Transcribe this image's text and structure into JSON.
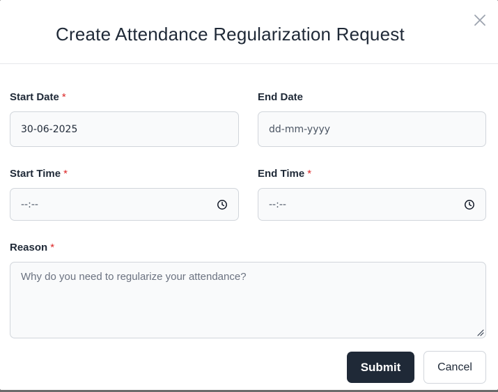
{
  "modal": {
    "title": "Create Attendance Regularization Request",
    "close_icon": "close-icon"
  },
  "form": {
    "start_date": {
      "label": "Start Date",
      "required_mark": "*",
      "value": "30-06-2025"
    },
    "end_date": {
      "label": "End Date",
      "placeholder": "dd-mm-yyyy"
    },
    "start_time": {
      "label": "Start Time",
      "required_mark": "*",
      "placeholder": "--:--",
      "icon": "clock-icon"
    },
    "end_time": {
      "label": "End Time",
      "required_mark": "*",
      "placeholder": "--:--",
      "icon": "clock-icon"
    },
    "reason": {
      "label": "Reason",
      "required_mark": "*",
      "placeholder": "Why do you need to regularize your attendance?"
    }
  },
  "actions": {
    "submit_label": "Submit",
    "cancel_label": "Cancel"
  },
  "colors": {
    "primary_button": "#1f2937",
    "required": "#dc2626",
    "field_bg": "#f9fafb",
    "field_border": "#d1d5db"
  }
}
